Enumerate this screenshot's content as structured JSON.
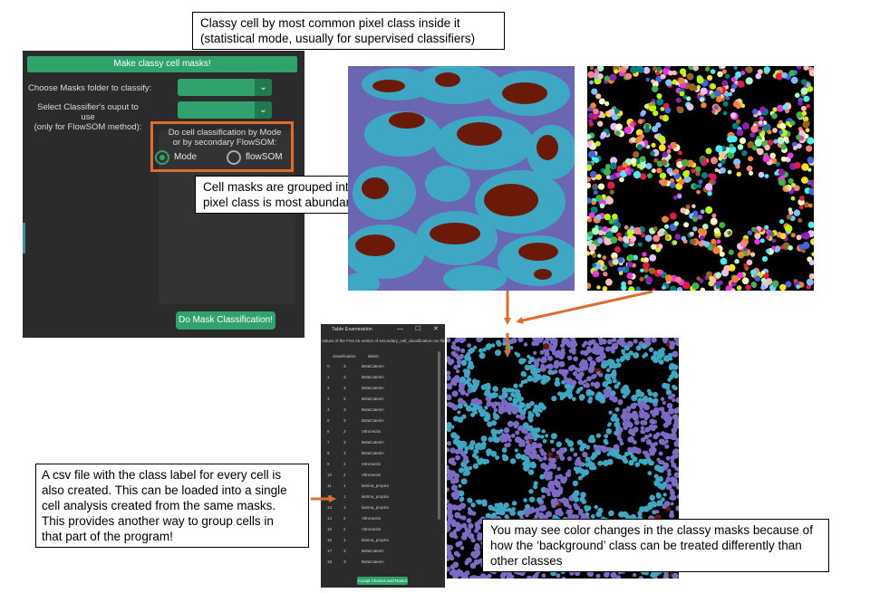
{
  "callouts": {
    "top": [
      "Classy cell by most common pixel class inside it",
      "(statistical mode, usually for supervised classifiers)"
    ],
    "mid": [
      "Cell masks are grouped into classes by which",
      "pixel class is most abundant inside them"
    ],
    "bottom_left": [
      "A csv file with the class label for every cell is",
      "also created. This can be loaded into a single",
      "cell analysis created from the same masks.",
      "This provides another way to group cells in",
      "that part of the program!"
    ],
    "bottom_right": [
      "You may see color changes in the classy masks because of",
      "how the ‘background’ class can be treated differently than",
      "other classes"
    ]
  },
  "app": {
    "make_button": "Make classy cell masks!",
    "masks_label": "Choose Masks folder to classify:",
    "classifier_label_1": "Select Classifier's ouput to use",
    "classifier_label_2": "(only for FlowSOM method):",
    "radio_question_1": "Do cell classification by Mode",
    "radio_question_2": "or by secondary FlowSOM:",
    "radio_options": [
      "Mode",
      "flowSOM"
    ],
    "selected_option": "Mode",
    "dropdown_chevron": "chevron-down-icon",
    "do_button": "Do Mask Classification!",
    "colors": {
      "panel": "#2b2b2b",
      "accent_green": "#2fa36b",
      "highlight_orange": "#e06c2c"
    }
  },
  "table_window": {
    "title": "Table Examination",
    "controls": [
      "—",
      "☐",
      "✕"
    ],
    "subtitle": "Values of the First 25 entries of secondary_cell_classification.csv file:",
    "headers": [
      "classification",
      "labels"
    ],
    "rows": [
      [
        "0",
        "3",
        "BetaCatenin"
      ],
      [
        "1",
        "3",
        "BetaCatenin"
      ],
      [
        "2",
        "3",
        "BetaCatenin"
      ],
      [
        "3",
        "3",
        "BetaCatenin"
      ],
      [
        "4",
        "3",
        "BetaCatenin"
      ],
      [
        "5",
        "3",
        "BetaCatenin"
      ],
      [
        "6",
        "2",
        "Vitronectin"
      ],
      [
        "7",
        "3",
        "BetaCatenin"
      ],
      [
        "8",
        "3",
        "BetaCatenin"
      ],
      [
        "9",
        "2",
        "Vitronectin"
      ],
      [
        "10",
        "2",
        "Vitronectin"
      ],
      [
        "11",
        "1",
        "lamina_propria"
      ],
      [
        "12",
        "1",
        "lamina_propria"
      ],
      [
        "13",
        "1",
        "lamina_propria"
      ],
      [
        "14",
        "2",
        "Vitronectin"
      ],
      [
        "15",
        "2",
        "Vitronectin"
      ],
      [
        "16",
        "1",
        "lamina_propria"
      ],
      [
        "17",
        "3",
        "BetaCatenin"
      ],
      [
        "18",
        "3",
        "BetaCatenin"
      ]
    ],
    "accept_button": "Accept Choices and Return"
  },
  "image_colors": {
    "pixel_map": {
      "background": "#6a66b4",
      "cyan": "#3ea8c4",
      "brown": "#6b1a08"
    },
    "masks": {
      "background": "#000000"
    },
    "classy": {
      "background": "#000000",
      "purple": "#7b6bc4",
      "cyan": "#3ea8c4"
    }
  }
}
